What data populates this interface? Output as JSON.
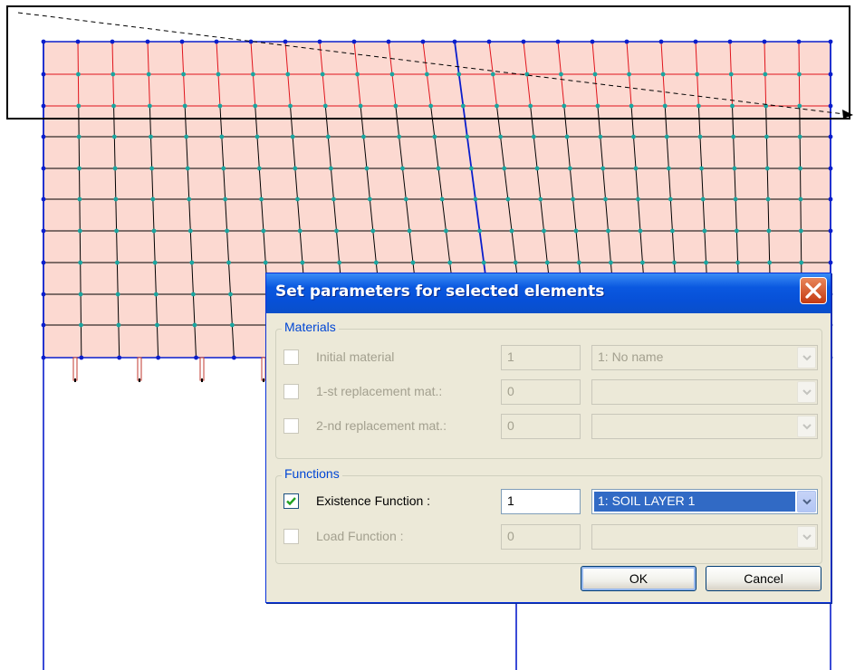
{
  "dialog": {
    "title": "Set parameters for selected elements",
    "materials_group": "Materials",
    "functions_group": "Functions",
    "ok_label": "OK",
    "cancel_label": "Cancel"
  },
  "materials": [
    {
      "label": "Initial material",
      "value": "1",
      "selected": "1: No name",
      "checked": false,
      "enabled": false
    },
    {
      "label": "1-st replacement mat.:",
      "value": "0",
      "selected": "",
      "checked": false,
      "enabled": false
    },
    {
      "label": "2-nd replacement mat.:",
      "value": "0",
      "selected": "",
      "checked": false,
      "enabled": false
    }
  ],
  "functions": [
    {
      "label": "Existence Function :",
      "value": "1",
      "selected": "1: SOIL LAYER 1",
      "checked": true,
      "enabled": true
    },
    {
      "label": "Load Function :",
      "value": "0",
      "selected": "",
      "checked": false,
      "enabled": false
    }
  ],
  "colors": {
    "mesh_fill": "#FCD9D1",
    "red_lines": "#E0141C",
    "black_lines": "#000000",
    "blue_lines": "#0A1ECC",
    "nodes": "#1AA6A0",
    "xp_title_blue": "#0750D7",
    "dialog_face": "#ECE9D8",
    "selection_blue": "#316AC5"
  }
}
